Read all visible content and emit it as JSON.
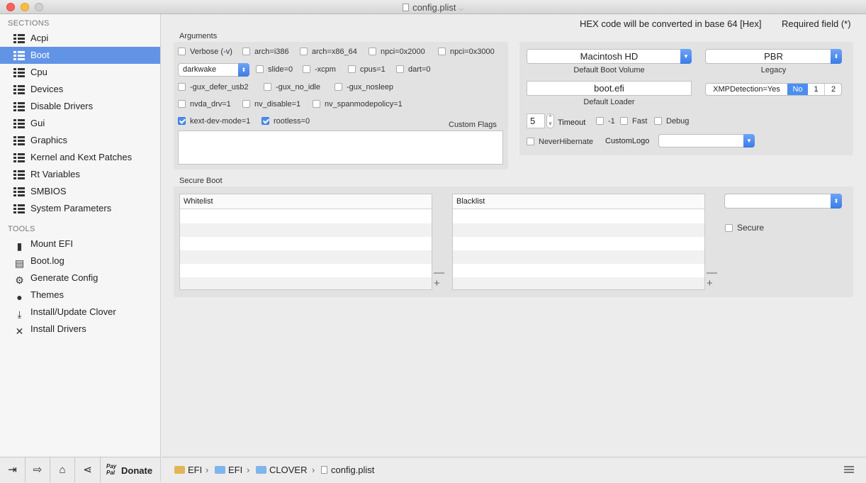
{
  "window": {
    "title": "config.plist"
  },
  "sidebar": {
    "sections_header": "SECTIONS",
    "sections": [
      {
        "label": "Acpi"
      },
      {
        "label": "Boot",
        "selected": true
      },
      {
        "label": "Cpu"
      },
      {
        "label": "Devices"
      },
      {
        "label": "Disable Drivers"
      },
      {
        "label": "Gui"
      },
      {
        "label": "Graphics"
      },
      {
        "label": "Kernel and Kext Patches"
      },
      {
        "label": "Rt Variables"
      },
      {
        "label": "SMBIOS"
      },
      {
        "label": "System Parameters"
      }
    ],
    "tools_header": "TOOLS",
    "tools": [
      {
        "label": "Mount EFI",
        "icon": "drive-icon"
      },
      {
        "label": "Boot.log",
        "icon": "log-icon"
      },
      {
        "label": "Generate Config",
        "icon": "gears-icon"
      },
      {
        "label": "Themes",
        "icon": "palette-icon"
      },
      {
        "label": "Install/Update Clover",
        "icon": "download-icon"
      },
      {
        "label": "Install Drivers",
        "icon": "tools-icon"
      }
    ],
    "footer": {
      "paypal": "Pay Pal",
      "donate": "Donate"
    }
  },
  "header": {
    "hex_note": "HEX code will be converted in base 64 [Hex]",
    "required_note": "Required field (*)"
  },
  "arguments": {
    "label": "Arguments",
    "row1": [
      {
        "label": "Verbose (-v)",
        "checked": false
      },
      {
        "label": "arch=i386",
        "checked": false
      },
      {
        "label": "arch=x86_64",
        "checked": false
      },
      {
        "label": "npci=0x2000",
        "checked": false
      },
      {
        "label": "npci=0x3000",
        "checked": false
      }
    ],
    "popup_value": "darkwake",
    "row2": [
      {
        "label": "slide=0",
        "checked": false
      },
      {
        "label": "-xcpm",
        "checked": false
      },
      {
        "label": "cpus=1",
        "checked": false
      },
      {
        "label": "dart=0",
        "checked": false
      }
    ],
    "row3": [
      {
        "label": "-gux_defer_usb2",
        "checked": false
      },
      {
        "label": "-gux_no_idle",
        "checked": false
      },
      {
        "label": "-gux_nosleep",
        "checked": false
      }
    ],
    "row4": [
      {
        "label": "nvda_drv=1",
        "checked": false
      },
      {
        "label": "nv_disable=1",
        "checked": false
      },
      {
        "label": "nv_spanmodepolicy=1",
        "checked": false
      }
    ],
    "row5": [
      {
        "label": "kext-dev-mode=1",
        "checked": true
      },
      {
        "label": "rootless=0",
        "checked": true
      }
    ],
    "custom_flags_label": "Custom Flags",
    "custom_flags_value": ""
  },
  "boot_opts": {
    "default_volume": "Macintosh HD",
    "default_volume_label": "Default Boot Volume",
    "legacy": "PBR",
    "legacy_label": "Legacy",
    "loader": "boot.efi",
    "loader_label": "Default Loader",
    "xmp_label": "XMPDetection=Yes",
    "xmp_options": [
      "No",
      "1",
      "2"
    ],
    "xmp_selected": "No",
    "timeout_value": "5",
    "timeout_label": "Timeout",
    "opts": [
      {
        "label": "-1",
        "checked": false
      },
      {
        "label": "Fast",
        "checked": false
      },
      {
        "label": "Debug",
        "checked": false
      }
    ],
    "never_hibernate": "NeverHibernate",
    "custom_logo": "CustomLogo",
    "custom_logo_value": ""
  },
  "secure_boot": {
    "label": "Secure Boot",
    "whitelist": "Whitelist",
    "blacklist": "Blacklist",
    "popup_value": "",
    "secure_label": "Secure",
    "minus": "—",
    "plus": "+"
  },
  "statusbar": {
    "path": [
      "EFI",
      "EFI",
      "CLOVER",
      "config.plist"
    ],
    "sep": "›"
  },
  "colors": {
    "accent": "#6294e6",
    "checkbox_on": "#4b8ef0"
  }
}
